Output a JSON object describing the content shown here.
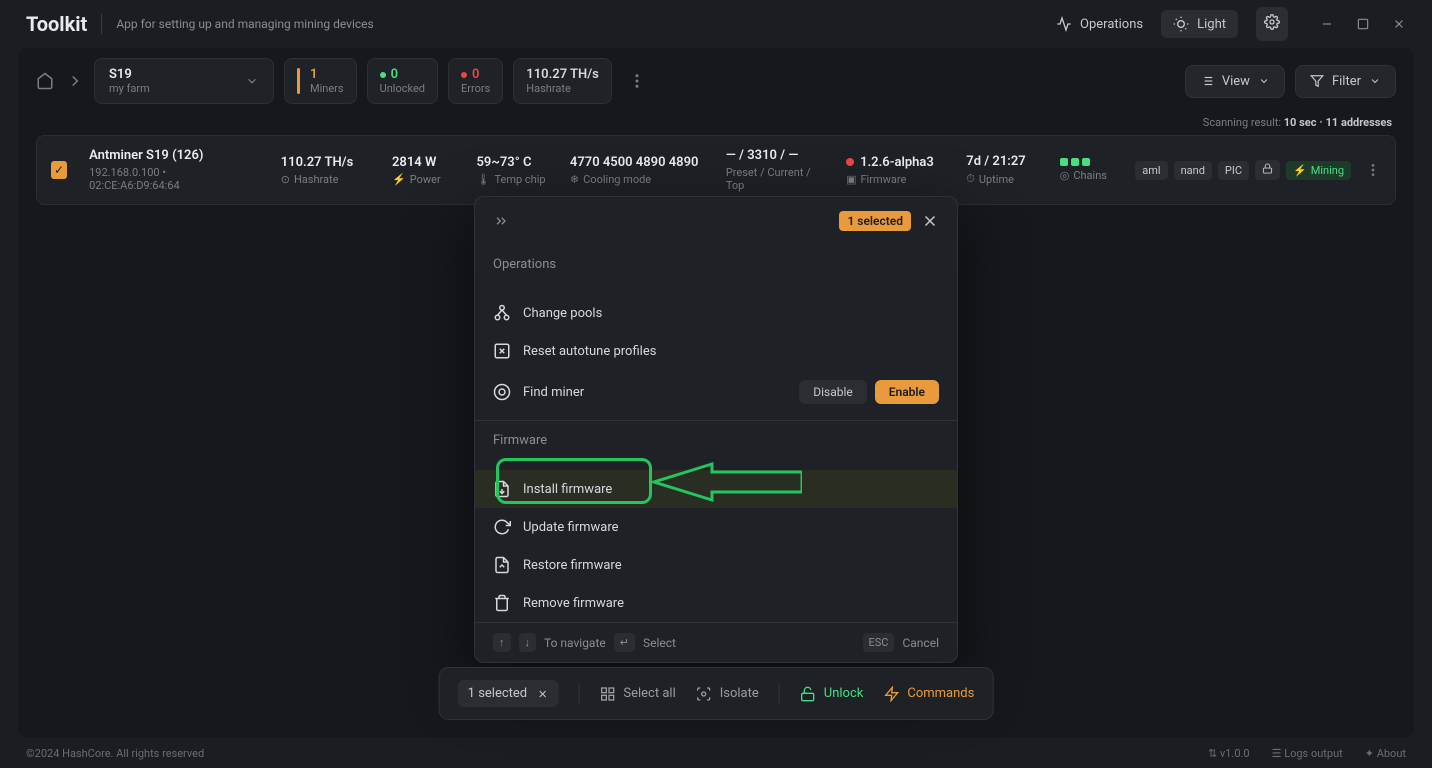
{
  "app": {
    "title": "Toolkit",
    "subtitle": "App for setting up and managing mining devices"
  },
  "titlebar": {
    "operations": "Operations",
    "light": "Light"
  },
  "farm": {
    "name": "S19",
    "sub": "my farm"
  },
  "stats": {
    "miners": {
      "val": "1",
      "lbl": "Miners"
    },
    "unlocked": {
      "val": "0",
      "lbl": "Unlocked"
    },
    "errors": {
      "val": "0",
      "lbl": "Errors"
    },
    "hashrate": {
      "val": "110.27 TH/s",
      "lbl": "Hashrate"
    }
  },
  "toolbar": {
    "view": "View",
    "filter": "Filter"
  },
  "scan": {
    "label": "Scanning result:",
    "time": "10 sec",
    "addr": "11 addresses"
  },
  "row": {
    "name": "Antminer S19 (126)",
    "ip": "192.168.0.100 • 02:CE:A6:D9:64:64",
    "hashrate": "110.27 TH/s",
    "hashrate_lbl": "Hashrate",
    "power": "2814 W",
    "power_lbl": "Power",
    "temp": "59~73° C",
    "temp_lbl": "Temp chip",
    "cooling": "4770   4500   4890   4890",
    "cooling_lbl": "Cooling mode",
    "preset": "— / 3310 / —",
    "preset_lbl": "Preset / Current / Top",
    "fw": "1.2.6-alpha3",
    "fw_lbl": "Firmware",
    "uptime": "7d / 21:27",
    "uptime_lbl": "Uptime",
    "chains_lbl": "Chains",
    "badges": {
      "aml": "aml",
      "nand": "nand",
      "pic": "PIC",
      "mining": "Mining"
    }
  },
  "modal": {
    "selected": "1 selected",
    "sec_ops": "Operations",
    "change_pools": "Change pools",
    "reset": "Reset autotune profiles",
    "find": "Find miner",
    "disable": "Disable",
    "enable": "Enable",
    "sec_fw": "Firmware",
    "install": "Install firmware",
    "update": "Update firmware",
    "restore": "Restore firmware",
    "remove": "Remove firmware",
    "nav": "To navigate",
    "select": "Select",
    "esc": "ESC",
    "cancel": "Cancel"
  },
  "bottombar": {
    "sel": "1 selected",
    "all": "Select all",
    "isolate": "Isolate",
    "unlock": "Unlock",
    "cmds": "Commands"
  },
  "footer": {
    "copy": "©2024 HashCore. All rights reserved",
    "ver": "v1.0.0",
    "logs": "Logs output",
    "about": "About"
  }
}
